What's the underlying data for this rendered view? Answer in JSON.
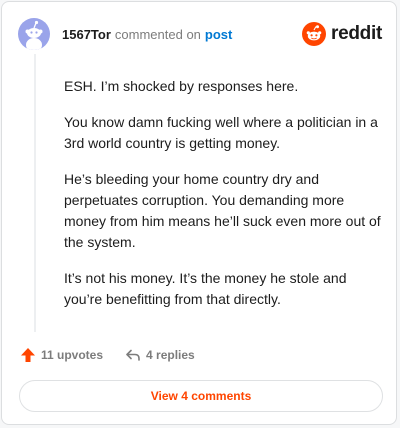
{
  "header": {
    "username": "1567Tor",
    "action_text": "commented on",
    "post_link": "post",
    "brand": "reddit"
  },
  "comment": {
    "paragraphs": [
      "ESH. I’m shocked by responses here.",
      "You know damn fucking well where a politician in a 3rd world country is getting money.",
      "He’s bleeding your home country dry and perpetuates corruption. You demanding more money from him means he’ll suck even more out of the system.",
      "It’s not his money. It’s the money he stole and you’re benefitting from that directly."
    ]
  },
  "actions": {
    "upvotes_label": "11 upvotes",
    "replies_label": "4 replies"
  },
  "footer": {
    "view_comments_label": "View 4 comments"
  },
  "colors": {
    "brand_orange": "#ff4500",
    "link_blue": "#0079d3",
    "avatar_bg": "#9aa4ea",
    "muted_text": "#7c7c7c"
  },
  "icons": {
    "avatar": "snoo-avatar-icon",
    "logo": "reddit-snoo-icon",
    "upvote": "upvote-arrow-icon",
    "reply": "reply-arrow-icon"
  }
}
